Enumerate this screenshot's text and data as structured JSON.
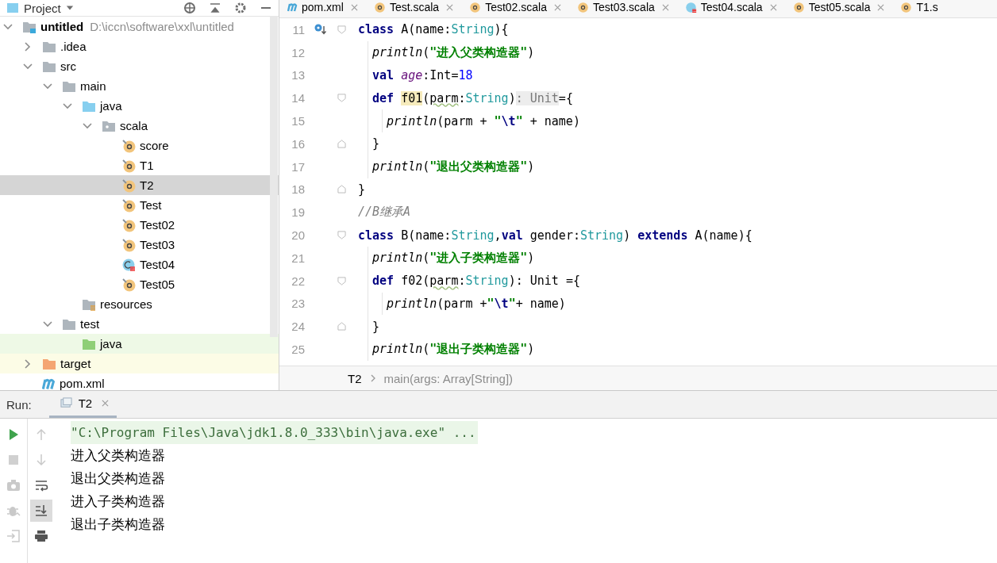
{
  "project": {
    "title": "Project",
    "tree": [
      {
        "label": "untitled",
        "kind": "project",
        "path": "D:\\iccn\\software\\xxl\\untitled",
        "expanded": true,
        "selected": false,
        "children": [
          {
            "label": ".idea",
            "kind": "folder",
            "expanded": false,
            "selected": false
          },
          {
            "label": "src",
            "kind": "folder",
            "expanded": true,
            "selected": false,
            "children": [
              {
                "label": "main",
                "kind": "folder",
                "expanded": true,
                "selected": false,
                "children": [
                  {
                    "label": "java",
                    "kind": "source",
                    "expanded": true,
                    "selected": false,
                    "children": [
                      {
                        "label": "scala",
                        "kind": "package",
                        "expanded": true,
                        "selected": false,
                        "children": [
                          {
                            "label": "score",
                            "kind": "object",
                            "selected": false
                          },
                          {
                            "label": "T1",
                            "kind": "object",
                            "selected": false
                          },
                          {
                            "label": "T2",
                            "kind": "object",
                            "selected": true
                          },
                          {
                            "label": "Test",
                            "kind": "object",
                            "selected": false
                          },
                          {
                            "label": "Test02",
                            "kind": "object",
                            "selected": false
                          },
                          {
                            "label": "Test03",
                            "kind": "object",
                            "selected": false
                          },
                          {
                            "label": "Test04",
                            "kind": "class",
                            "selected": false
                          },
                          {
                            "label": "Test05",
                            "kind": "object",
                            "selected": false
                          }
                        ]
                      }
                    ]
                  },
                  {
                    "label": "resources",
                    "kind": "resources",
                    "selected": false
                  }
                ]
              },
              {
                "label": "test",
                "kind": "folder",
                "expanded": true,
                "selected": false,
                "children": [
                  {
                    "label": "java",
                    "kind": "test-source",
                    "selected": false
                  }
                ]
              }
            ]
          },
          {
            "label": "target",
            "kind": "excluded",
            "expanded": false,
            "selected": false
          },
          {
            "label": "pom.xml",
            "kind": "maven",
            "selected": false
          }
        ]
      }
    ]
  },
  "editor_tabs": [
    {
      "label": "pom.xml",
      "kind": "maven"
    },
    {
      "label": "Test.scala",
      "kind": "object"
    },
    {
      "label": "Test02.scala",
      "kind": "object"
    },
    {
      "label": "Test03.scala",
      "kind": "object"
    },
    {
      "label": "Test04.scala",
      "kind": "class"
    },
    {
      "label": "Test05.scala",
      "kind": "object"
    },
    {
      "label": "T1.s",
      "kind": "object"
    }
  ],
  "code": [
    {
      "number": "11",
      "override": true,
      "fold_start": true,
      "tokens": [
        {
          "kind": "kw",
          "text": "class"
        },
        {
          "kind": "plain",
          "text": " A(name:"
        },
        {
          "kind": "type",
          "text": "String"
        },
        {
          "kind": "plain",
          "text": "){"
        }
      ],
      "children": [
        {
          "number": "12",
          "tokens": [
            {
              "kind": "call",
              "text": "println"
            },
            {
              "kind": "plain",
              "text": "("
            },
            {
              "kind": "str",
              "text": "\"进入父类构造器\""
            },
            {
              "kind": "plain",
              "text": ")"
            }
          ]
        },
        {
          "number": "13",
          "tokens": [
            {
              "kind": "kw",
              "text": "val "
            },
            {
              "kind": "field",
              "text": "age"
            },
            {
              "kind": "plain",
              "text": ":Int="
            },
            {
              "kind": "num",
              "text": "18"
            }
          ]
        },
        {
          "number": "14",
          "fold_start": true,
          "tokens": [
            {
              "kind": "kw",
              "text": "def "
            },
            {
              "kind": "highlight",
              "text": "f01"
            },
            {
              "kind": "plain",
              "text": "("
            },
            {
              "kind": "warn",
              "text": "parm"
            },
            {
              "kind": "plain",
              "text": ":"
            },
            {
              "kind": "type",
              "text": "String"
            },
            {
              "kind": "plain",
              "text": ")"
            },
            {
              "kind": "hint",
              "text": ": Unit"
            },
            {
              "kind": "plain",
              "text": "={"
            }
          ],
          "children": [
            {
              "number": "15",
              "tokens": [
                {
                  "kind": "call",
                  "text": "println"
                },
                {
                  "kind": "plain",
                  "text": "(parm + "
                },
                {
                  "kind": "str",
                  "text": "\""
                },
                {
                  "kind": "esc",
                  "text": "\\t"
                },
                {
                  "kind": "str",
                  "text": "\""
                },
                {
                  "kind": "plain",
                  "text": " + name)"
                }
              ]
            }
          ]
        },
        {
          "number": "16",
          "fold_end": true,
          "tokens": [
            {
              "kind": "plain",
              "text": "}"
            }
          ]
        },
        {
          "number": "17",
          "tokens": [
            {
              "kind": "call",
              "text": "println"
            },
            {
              "kind": "plain",
              "text": "("
            },
            {
              "kind": "str",
              "text": "\"退出父类构造器\""
            },
            {
              "kind": "plain",
              "text": ")"
            }
          ]
        }
      ]
    },
    {
      "number": "18",
      "fold_end": true,
      "tokens": [
        {
          "kind": "plain",
          "text": "}"
        }
      ]
    },
    {
      "number": "19",
      "tokens": [
        {
          "kind": "comment",
          "text": "//B继承A"
        }
      ]
    },
    {
      "number": "20",
      "fold_start": true,
      "tokens": [
        {
          "kind": "kw",
          "text": "class"
        },
        {
          "kind": "plain",
          "text": " B(name:"
        },
        {
          "kind": "type",
          "text": "String"
        },
        {
          "kind": "plain",
          "text": ","
        },
        {
          "kind": "kw",
          "text": "val"
        },
        {
          "kind": "plain",
          "text": " gender:"
        },
        {
          "kind": "type",
          "text": "String"
        },
        {
          "kind": "plain",
          "text": ") "
        },
        {
          "kind": "kw",
          "text": "extends"
        },
        {
          "kind": "plain",
          "text": " A(name){"
        }
      ],
      "children": [
        {
          "number": "21",
          "tokens": [
            {
              "kind": "call",
              "text": "println"
            },
            {
              "kind": "plain",
              "text": "("
            },
            {
              "kind": "str",
              "text": "\"进入子类构造器\""
            },
            {
              "kind": "plain",
              "text": ")"
            }
          ]
        },
        {
          "number": "22",
          "fold_start": true,
          "tokens": [
            {
              "kind": "kw",
              "text": "def"
            },
            {
              "kind": "plain",
              "text": " f02("
            },
            {
              "kind": "warn",
              "text": "parm"
            },
            {
              "kind": "plain",
              "text": ":"
            },
            {
              "kind": "type",
              "text": "String"
            },
            {
              "kind": "plain",
              "text": "): Unit ={"
            }
          ],
          "children": [
            {
              "number": "23",
              "tokens": [
                {
                  "kind": "call",
                  "text": "println"
                },
                {
                  "kind": "plain",
                  "text": "(parm +"
                },
                {
                  "kind": "str",
                  "text": "\""
                },
                {
                  "kind": "esc",
                  "text": "\\t"
                },
                {
                  "kind": "str",
                  "text": "\""
                },
                {
                  "kind": "plain",
                  "text": "+ name)"
                }
              ]
            }
          ]
        },
        {
          "number": "24",
          "fold_end": true,
          "tokens": [
            {
              "kind": "plain",
              "text": "}"
            }
          ]
        },
        {
          "number": "25",
          "tokens": [
            {
              "kind": "call",
              "text": "println"
            },
            {
              "kind": "plain",
              "text": "("
            },
            {
              "kind": "str",
              "text": "\"退出子类构造器\""
            },
            {
              "kind": "plain",
              "text": ")"
            }
          ]
        }
      ]
    }
  ],
  "breadcrumb": [
    "T2",
    "main(args: Array[String])"
  ],
  "run": {
    "label": "Run:",
    "tabs": [
      {
        "label": "T2",
        "selected": true
      }
    ],
    "tools": [
      {
        "kind": "run",
        "disabled": false
      },
      {
        "kind": "up",
        "disabled": true
      },
      {
        "kind": "stop",
        "disabled": true
      },
      {
        "kind": "down",
        "disabled": true
      },
      {
        "kind": "camera",
        "disabled": true
      },
      {
        "kind": "wrap",
        "disabled": false
      },
      {
        "kind": "bug",
        "disabled": true
      },
      {
        "kind": "scroll-end",
        "disabled": false,
        "selected": true
      },
      {
        "kind": "exit",
        "disabled": true
      },
      {
        "kind": "print",
        "disabled": false
      }
    ],
    "console": [
      {
        "kind": "command",
        "text": "\"C:\\Program Files\\Java\\jdk1.8.0_333\\bin\\java.exe\" ..."
      },
      {
        "kind": "output",
        "text": "进入父类构造器"
      },
      {
        "kind": "output",
        "text": "退出父类构造器"
      },
      {
        "kind": "output",
        "text": "进入子类构造器"
      },
      {
        "kind": "output",
        "text": "退出子类构造器"
      }
    ]
  }
}
